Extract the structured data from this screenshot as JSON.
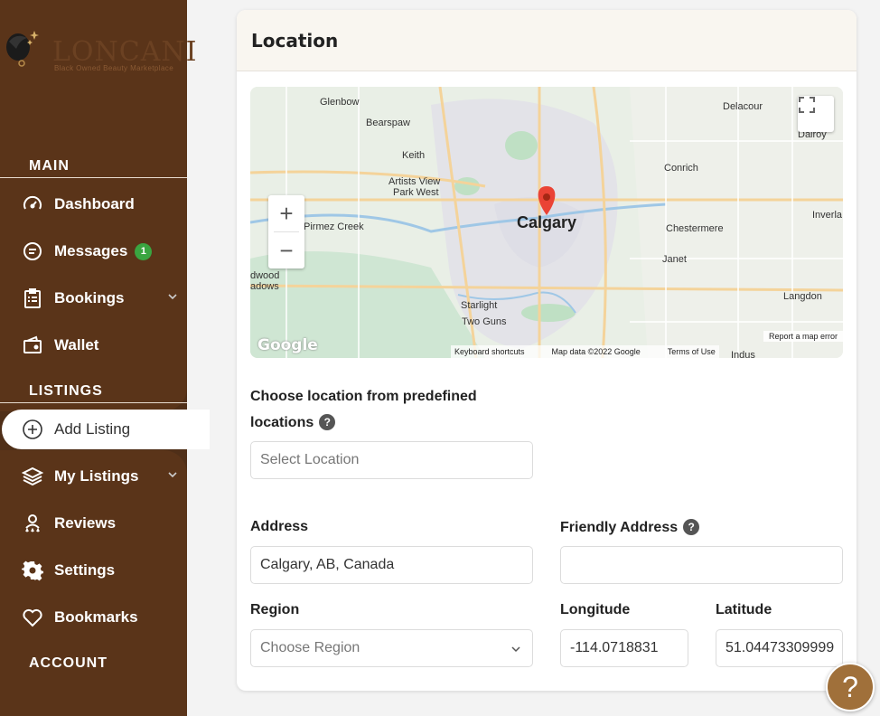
{
  "brand": {
    "name": "LONCANI",
    "tagline": "Black Owned Beauty Marketplace"
  },
  "sidebar": {
    "sections": {
      "main": "MAIN",
      "listings": "LISTINGS",
      "account": "ACCOUNT"
    },
    "items": [
      {
        "label": "Dashboard",
        "icon": "gauge-icon"
      },
      {
        "label": "Messages",
        "icon": "chat-icon",
        "badge": "1"
      },
      {
        "label": "Bookings",
        "icon": "clipboard-icon"
      },
      {
        "label": "Wallet",
        "icon": "wallet-icon"
      },
      {
        "label": "Add Listing",
        "icon": "plus-circle-icon"
      },
      {
        "label": "My Listings",
        "icon": "layers-icon"
      },
      {
        "label": "Reviews",
        "icon": "reviews-icon"
      },
      {
        "label": "Settings",
        "icon": "gear-icon"
      },
      {
        "label": "Bookmarks",
        "icon": "heart-icon"
      }
    ]
  },
  "card": {
    "title": "Location"
  },
  "map": {
    "places": {
      "glenbow": "Glenbow",
      "bearspaw": "Bearspaw",
      "keith": "Keith",
      "artists1": "Artists View",
      "artists2": "Park West",
      "pirmez": "Pirmez Creek",
      "edwood": "dwood",
      "meadows": "adows",
      "starlight": "Starlight",
      "twoguns": "Two Guns",
      "calgary": "Calgary",
      "delacour": "Delacour",
      "dalroy": "Dalroy",
      "conrich": "Conrich",
      "chestermere": "Chestermere",
      "inverlake": "Inverla",
      "janet": "Janet",
      "langdon": "Langdon",
      "indus": "Indus"
    },
    "attribution": {
      "shortcuts": "Keyboard shortcuts",
      "data": "Map data ©2022 Google",
      "terms": "Terms of Use",
      "report": "Report a map error",
      "logo": "Google"
    },
    "zoom_in": "+",
    "zoom_out": "−"
  },
  "form": {
    "predefined": {
      "label_line1": "Choose location from predefined",
      "label_line2": "locations",
      "placeholder": "Select Location"
    },
    "address": {
      "label": "Address",
      "value": "Calgary, AB, Canada"
    },
    "friendly": {
      "label": "Friendly Address",
      "value": ""
    },
    "region": {
      "label": "Region",
      "placeholder": "Choose Region"
    },
    "longitude": {
      "label": "Longitude",
      "value": "-114.0718831"
    },
    "latitude": {
      "label": "Latitude",
      "value": "51.04473309999"
    },
    "help_glyph": "?"
  },
  "support": {
    "glyph": "?"
  }
}
